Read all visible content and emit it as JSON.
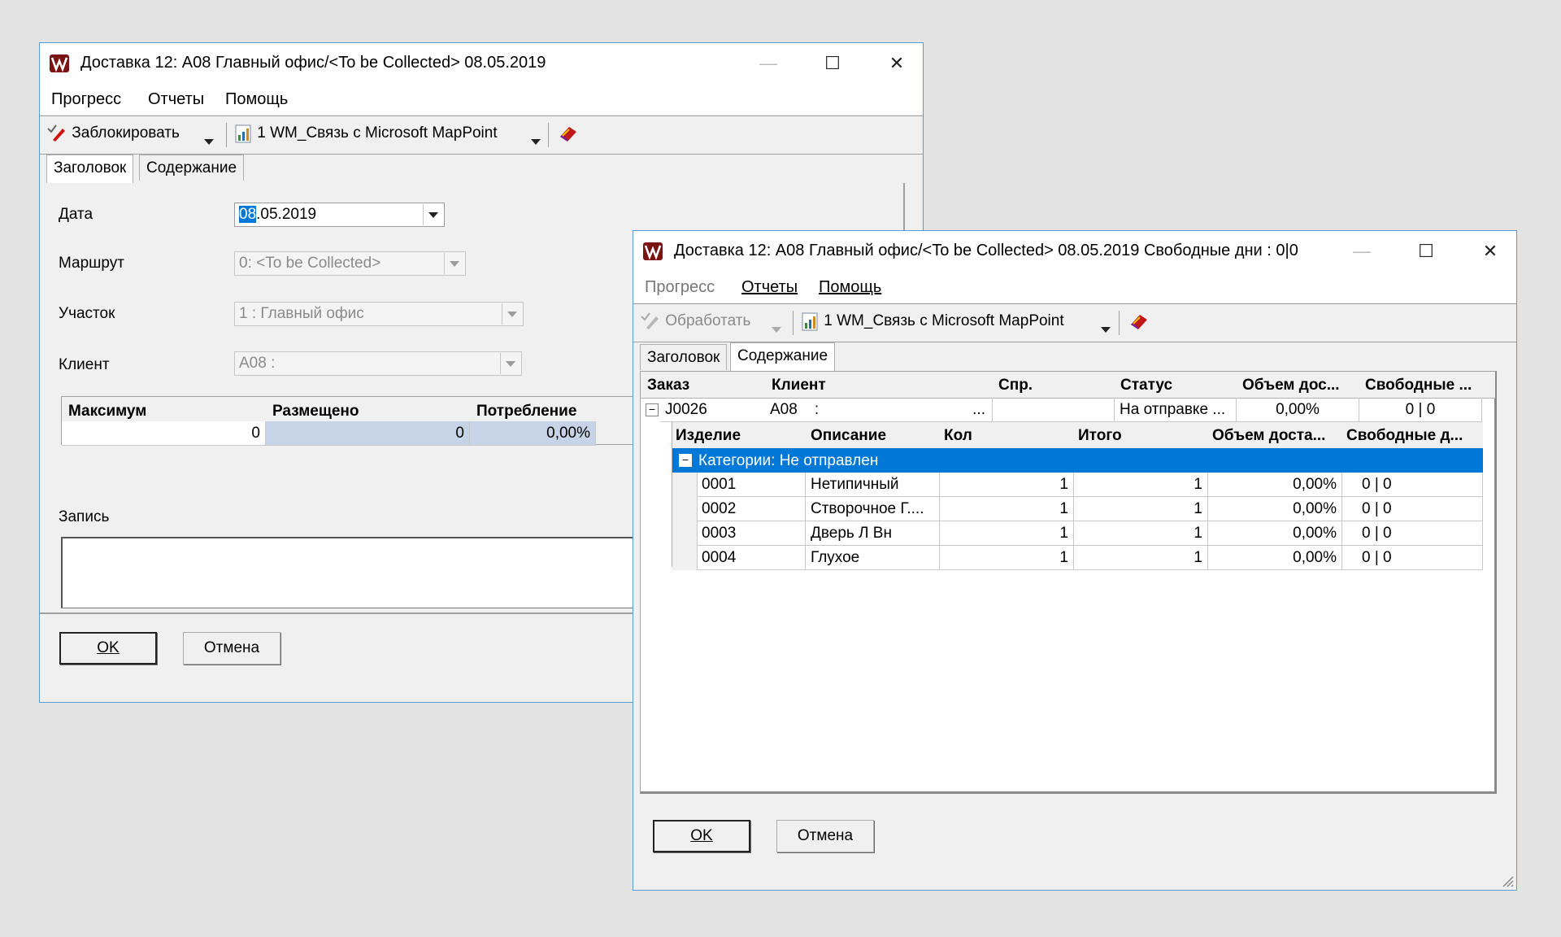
{
  "win1": {
    "title": "Доставка 12: A08  Главный офис/<To be Collected> 08.05.2019",
    "menu": [
      "Прогресс",
      "Отчеты",
      "Помощь"
    ],
    "toolbar": {
      "action": "Заблокировать",
      "report": "1 WM_Связь с Microsoft MapPoint"
    },
    "tabs": [
      "Заголовок",
      "Содержание"
    ],
    "fields": {
      "date_label": "Дата",
      "date_day": "08",
      "date_rest": ".05.2019",
      "route_label": "Маршрут",
      "route_value": "0: <To be Collected>",
      "area_label": "Участок",
      "area_value": "1 : Главный офис",
      "client_label": "Клиент",
      "client_value": "A08 :"
    },
    "capacity": {
      "headers": [
        "Максимум",
        "Размещено",
        "Потребление"
      ],
      "values": [
        "0",
        "0",
        "0,00%"
      ]
    },
    "note_label": "Запись",
    "ok": "OK",
    "cancel": "Отмена"
  },
  "win2": {
    "title": "Доставка 12: A08  Главный офис/<To be Collected> 08.05.2019  Свободные дни : 0|0",
    "menu": [
      "Прогресс",
      "Отчеты",
      "Помощь"
    ],
    "toolbar": {
      "action": "Обработать",
      "report": "1 WM_Связь с Microsoft MapPoint"
    },
    "tabs": [
      "Заголовок",
      "Содержание"
    ],
    "orders": {
      "headers": [
        "Заказ",
        "Клиент",
        "Спр.",
        "Статус",
        "Объем дос...",
        "Свободные ..."
      ],
      "row": {
        "toggle": "−",
        "order": "J0026",
        "client": "A08    :",
        "client_more": "...",
        "spr": "",
        "status": "На отправке ...",
        "volume": "0,00%",
        "free": "0 | 0"
      }
    },
    "items": {
      "headers": [
        "Изделие",
        "Описание",
        "Кол",
        "Итого",
        "Объем доста...",
        "Свободные д..."
      ],
      "group_toggle": "−",
      "group": "Категории: Не отправлен",
      "rows": [
        {
          "item": "0001",
          "desc": "Нетипичный",
          "qty": "1",
          "total": "1",
          "vol": "0,00%",
          "free": "0 | 0"
        },
        {
          "item": "0002",
          "desc": "Створочное Г....",
          "qty": "1",
          "total": "1",
          "vol": "0,00%",
          "free": "0 | 0"
        },
        {
          "item": "0003",
          "desc": "Дверь Л Вн",
          "qty": "1",
          "total": "1",
          "vol": "0,00%",
          "free": "0 | 0"
        },
        {
          "item": "0004",
          "desc": "Глухое",
          "qty": "1",
          "total": "1",
          "vol": "0,00%",
          "free": "0 | 0"
        }
      ]
    },
    "ok": "OK",
    "cancel": "Отмена"
  },
  "colors": {
    "selection": "#0078d7",
    "frame": "#5b9bd5",
    "capacity_fill": "#c7d3e6"
  }
}
